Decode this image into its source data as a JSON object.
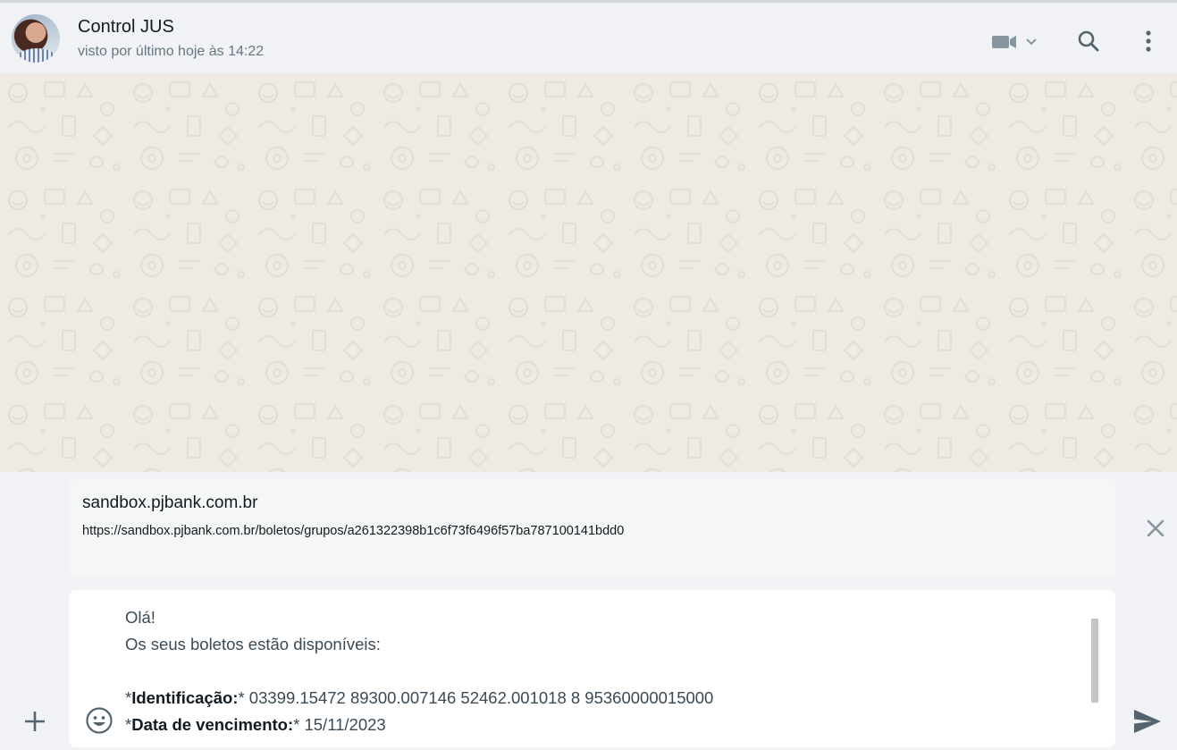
{
  "header": {
    "contact_name": "Control JUS",
    "contact_status": "visto por último hoje às 14:22",
    "icons": [
      "video-call-icon",
      "chevron-down-icon",
      "search-icon",
      "menu-dots-icon"
    ]
  },
  "link_preview": {
    "title": "sandbox.pjbank.com.br",
    "url": "https://sandbox.pjbank.com.br/boletos/grupos/a261322398b1c6f73f6496f57ba787100141bdd0"
  },
  "composer": {
    "greeting": "Olá!",
    "line2": "Os seus boletos estão disponíveis:",
    "field1_prefix": "*",
    "field1_label": "Identificação:",
    "field1_suffix": "*",
    "field1_value": " 03399.15472 89300.007146 52462.001018 8 95360000015000",
    "field2_prefix": "*",
    "field2_label": "Data de vencimento:",
    "field2_suffix": "*",
    "field2_value": " 15/11/2023"
  },
  "colors": {
    "header_bg": "#f0f2f5",
    "chat_bg": "#efeae2",
    "icon": "#54656f",
    "text_primary": "#111b21",
    "text_secondary": "#667781"
  }
}
